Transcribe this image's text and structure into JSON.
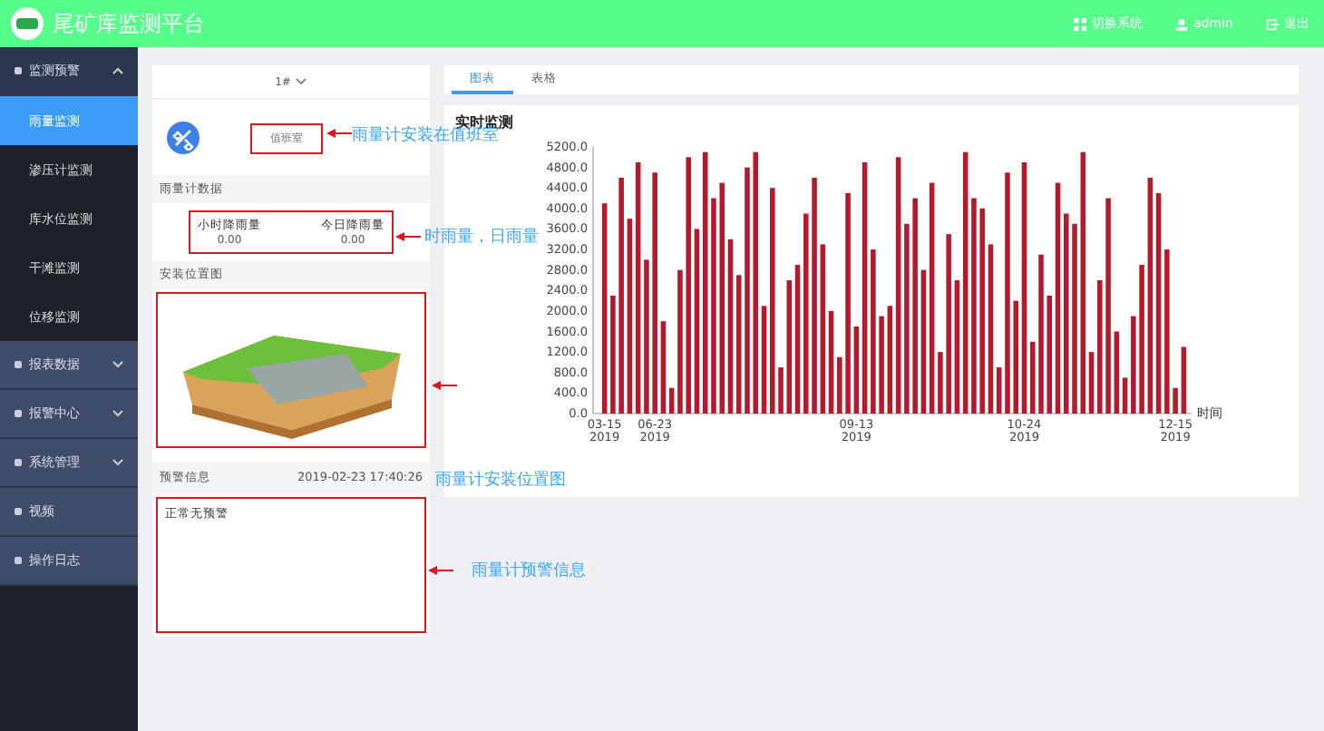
{
  "header": {
    "title": "尾矿库监测平台",
    "actions": [
      {
        "label": "切换系统",
        "kind": "grid"
      },
      {
        "label": "admin",
        "kind": "user"
      },
      {
        "label": "退出",
        "kind": "exit"
      }
    ]
  },
  "sidebar": {
    "groups": [
      {
        "label": "监测预警",
        "expanded": true,
        "children": [
          {
            "label": "雨量监测",
            "selected": true
          },
          {
            "label": "渗压计监测",
            "selected": false
          },
          {
            "label": "库水位监测",
            "selected": false
          },
          {
            "label": "干滩监测",
            "selected": false
          },
          {
            "label": "位移监测",
            "selected": false
          }
        ]
      },
      {
        "label": "报表数据",
        "expanded": false
      },
      {
        "label": "报警中心",
        "expanded": false
      },
      {
        "label": "系统管理",
        "expanded": false
      },
      {
        "label": "视频"
      },
      {
        "label": "操作日志"
      }
    ]
  },
  "station": {
    "select": "1#",
    "location": "值班室",
    "data_title": "雨量计数据",
    "metrics": [
      {
        "label": "小时降雨量",
        "value": "0.00"
      },
      {
        "label": "今日降雨量",
        "value": "0.00"
      }
    ],
    "image_title": "安装位置图",
    "warning_title": "预警信息",
    "warning_time": "2019-02-23 17:40:26",
    "warning_text": "正常无预警"
  },
  "tabs": [
    {
      "label": "图表",
      "selected": true
    },
    {
      "label": "表格",
      "selected": false
    }
  ],
  "chart_panel": {
    "title": "实时监测",
    "chart_data": {
      "type": "bar",
      "xlabel": "时间",
      "categories": [
        "03-15 2019",
        null,
        null,
        null,
        null,
        null,
        "06-23 2019",
        null,
        null,
        null,
        null,
        null,
        null,
        null,
        null,
        null,
        null,
        null,
        null,
        null,
        null,
        null,
        null,
        null,
        null,
        null,
        null,
        null,
        null,
        null,
        "09-13 2019",
        null,
        null,
        null,
        null,
        null,
        null,
        null,
        null,
        null,
        null,
        null,
        null,
        null,
        null,
        null,
        null,
        null,
        null,
        null,
        "10-24 2019",
        null,
        null,
        null,
        null,
        null,
        null,
        null,
        null,
        null,
        null,
        null,
        null,
        null,
        null,
        null,
        null,
        null,
        "12-15 2019",
        null
      ],
      "values": [
        4100,
        2300,
        4600,
        3800,
        4900,
        3000,
        4700,
        1800,
        500,
        2800,
        5000,
        3600,
        5100,
        4200,
        4500,
        3400,
        2700,
        4800,
        5100,
        2100,
        4400,
        900,
        2600,
        2900,
        3900,
        4600,
        3300,
        2000,
        1100,
        4300,
        1700,
        4900,
        3200,
        1900,
        2100,
        5000,
        3700,
        4200,
        2800,
        4500,
        1200,
        3500,
        2600,
        5100,
        4200,
        4000,
        3300,
        900,
        4700,
        2200,
        4900,
        1400,
        3100,
        2300,
        4500,
        3900,
        3700,
        5100,
        1200,
        2600,
        4200,
        1600,
        700,
        1900,
        2900,
        4600,
        4300,
        3200,
        500,
        1300
      ],
      "ylim": [
        0,
        5200
      ],
      "yticks": [
        {
          "value": 0,
          "label": "0.0"
        },
        {
          "value": 400,
          "label": "400.0"
        },
        {
          "value": 800,
          "label": "800.0"
        },
        {
          "value": 1200,
          "label": "1200.0"
        },
        {
          "value": 1600,
          "label": "1600.0"
        },
        {
          "value": 2000,
          "label": "2000.0"
        },
        {
          "value": 2400,
          "label": "2400.0"
        },
        {
          "value": 2800,
          "label": "2800.0"
        },
        {
          "value": 3200,
          "label": "3200.0"
        },
        {
          "value": 3600,
          "label": "3600.0"
        },
        {
          "value": 4000,
          "label": "4000.0"
        },
        {
          "value": 4400,
          "label": "4400.0"
        },
        {
          "value": 4800,
          "label": "4800.0"
        },
        {
          "value": 5200,
          "label": "5200.0"
        }
      ]
    }
  },
  "annotations": [
    "雨量计安装在值班室",
    "时雨量，日雨量",
    "雨量计安装位置图",
    "雨量计预警信息"
  ]
}
